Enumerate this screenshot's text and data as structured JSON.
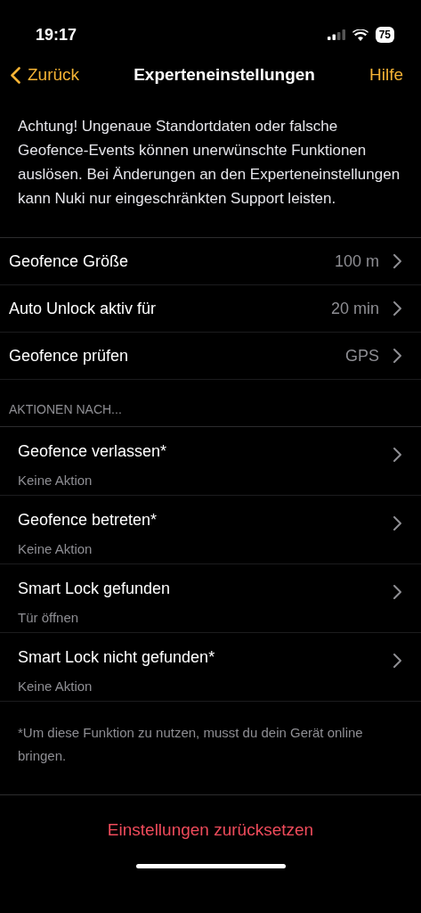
{
  "status_bar": {
    "time": "19:17",
    "battery": "75"
  },
  "nav": {
    "back": "Zurück",
    "title": "Experteneinstellungen",
    "help": "Hilfe"
  },
  "warning": "Achtung! Ungenaue Standortdaten oder falsche Geofence-Events können unerwünschte Funktionen auslösen. Bei Änderungen an den Experteneinstellungen kann Nuki nur eingeschränkten Support leisten.",
  "settings": [
    {
      "label": "Geofence Größe",
      "value": "100 m"
    },
    {
      "label": "Auto Unlock aktiv für",
      "value": "20 min"
    },
    {
      "label": "Geofence prüfen",
      "value": "GPS"
    }
  ],
  "actions_header": "AKTIONEN NACH...",
  "actions": [
    {
      "label": "Geofence verlassen*",
      "value": "Keine Aktion"
    },
    {
      "label": "Geofence betreten*",
      "value": "Keine Aktion"
    },
    {
      "label": "Smart Lock gefunden",
      "value": "Tür öffnen"
    },
    {
      "label": "Smart Lock nicht gefunden*",
      "value": "Keine Aktion"
    }
  ],
  "footnote": "*Um diese Funktion zu nutzen, musst du dein Gerät online bringen.",
  "reset_button": "Einstellungen zurücksetzen"
}
